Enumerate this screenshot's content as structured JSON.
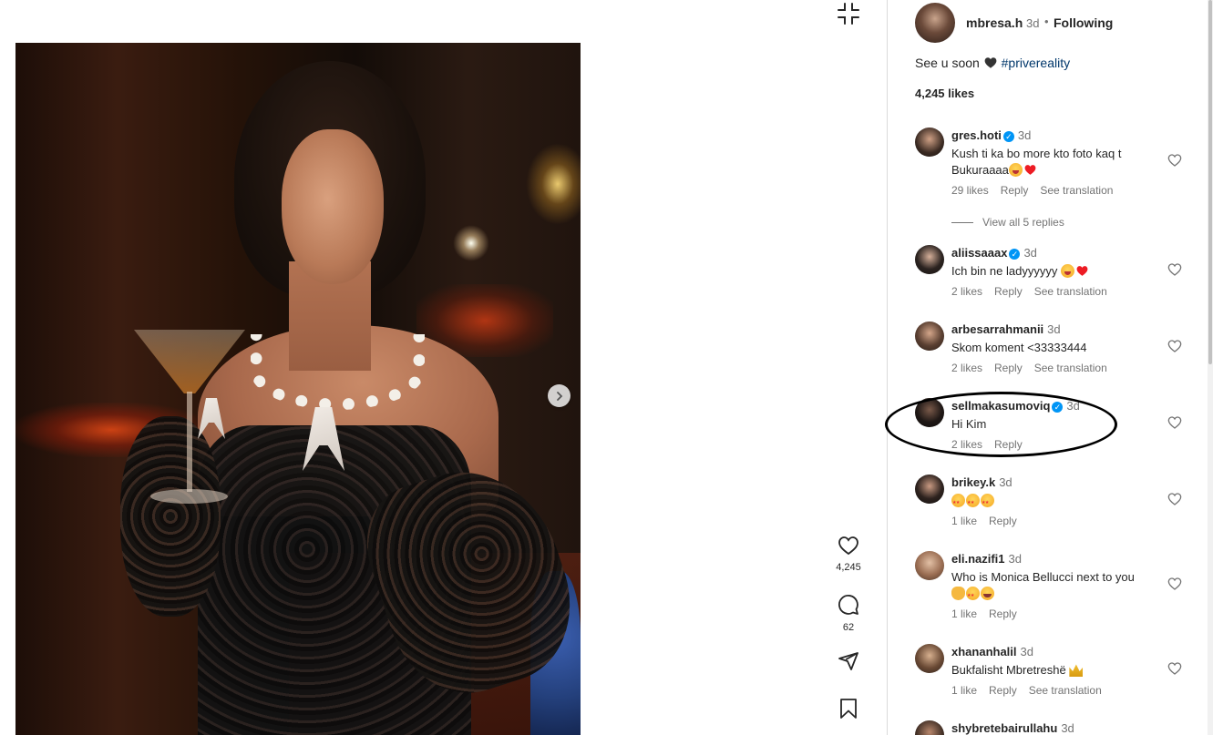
{
  "post": {
    "author": "mbresa.h",
    "time": "3d",
    "dot": "•",
    "follow_state": "Following",
    "caption_text": "See u soon",
    "caption_hashtag": "#privereality",
    "likes": "4,245 likes"
  },
  "rail": {
    "like_count": "4,245",
    "comment_count": "62"
  },
  "view_replies": "View all 5 replies",
  "comments": [
    {
      "user": "gres.hoti",
      "verified": true,
      "time": "3d",
      "text_1": "Kush ti ka bo more kto foto kaq t",
      "text_2": "Bukuraaaa",
      "likes": "29 likes",
      "reply": "Reply",
      "translation": "See translation"
    },
    {
      "user": "aliissaaax",
      "verified": true,
      "time": "3d",
      "text_1": "Ich bin ne ladyyyyyy",
      "likes": "2 likes",
      "reply": "Reply",
      "translation": "See translation"
    },
    {
      "user": "arbesarrahmanii",
      "verified": false,
      "time": "3d",
      "text_1": "Skom koment <33333444",
      "likes": "2 likes",
      "reply": "Reply",
      "translation": "See translation"
    },
    {
      "user": "sellmakasumoviq",
      "verified": true,
      "time": "3d",
      "text_1": "Hi Kim",
      "likes": "2 likes",
      "reply": "Reply"
    },
    {
      "user": "brikey.k",
      "verified": false,
      "time": "3d",
      "likes": "1 like",
      "reply": "Reply"
    },
    {
      "user": "eli.nazifi1",
      "verified": false,
      "time": "3d",
      "text_1": "Who is Monica Bellucci next to you",
      "likes": "1 like",
      "reply": "Reply"
    },
    {
      "user": "xhananhalil",
      "verified": false,
      "time": "3d",
      "text_1": "Bukfalisht Mbretreshë",
      "likes": "1 like",
      "reply": "Reply",
      "translation": "See translation"
    },
    {
      "user": "shybretebairullahu",
      "verified": false,
      "time": "3d"
    }
  ],
  "icons": {
    "collapse": "collapse-icon",
    "next": "chevron-right-icon",
    "like": "heart-icon",
    "comment": "comment-icon",
    "share": "send-icon",
    "save": "bookmark-icon",
    "verified": "verified-badge-icon"
  },
  "colors": {
    "verified": "#0095f6",
    "link": "#00376b",
    "muted": "#737373",
    "heart_red": "#ed1c24"
  }
}
